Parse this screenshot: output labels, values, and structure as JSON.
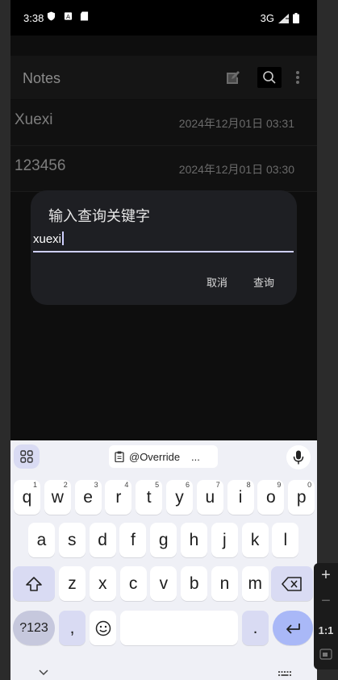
{
  "status_bar": {
    "time": "3:38",
    "network": "3G"
  },
  "app_bar": {
    "title": "Notes"
  },
  "notes": [
    {
      "title": "Xuexi",
      "date": "2024年12月01日 03:31"
    },
    {
      "title": "123456",
      "date": "2024年12月01日 03:30"
    }
  ],
  "dialog": {
    "title": "输入查询关键字",
    "input_value": "xuexi",
    "cancel_label": "取消",
    "query_label": "查询"
  },
  "keyboard": {
    "clipboard_chip": "@Override",
    "clipboard_more": "...",
    "row1": [
      {
        "k": "q",
        "h": "1"
      },
      {
        "k": "w",
        "h": "2"
      },
      {
        "k": "e",
        "h": "3"
      },
      {
        "k": "r",
        "h": "4"
      },
      {
        "k": "t",
        "h": "5"
      },
      {
        "k": "y",
        "h": "6"
      },
      {
        "k": "u",
        "h": "7"
      },
      {
        "k": "i",
        "h": "8"
      },
      {
        "k": "o",
        "h": "9"
      },
      {
        "k": "p",
        "h": "0"
      }
    ],
    "row2": [
      "a",
      "s",
      "d",
      "f",
      "g",
      "h",
      "j",
      "k",
      "l"
    ],
    "row3": [
      "z",
      "x",
      "c",
      "v",
      "b",
      "n",
      "m"
    ],
    "symbols_label": "?123",
    "comma_label": ",",
    "period_label": "."
  },
  "side_controls": {
    "zoom_label": "1:1"
  }
}
